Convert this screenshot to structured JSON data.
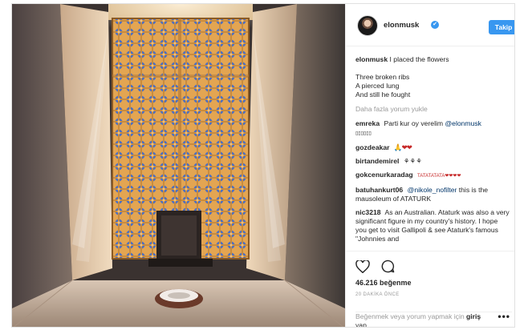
{
  "post": {
    "image_alt": "Mausoleum window with lattice and flowers",
    "author": "elonmusk",
    "verified_mark": "✔",
    "follow_label": "Takip Et",
    "caption_user": "elonmusk",
    "caption_text": "I placed the flowers",
    "poem": [
      "Three broken ribs",
      "A pierced lung",
      "And still he fought"
    ],
    "load_more": "Daha fazla yorum yukle",
    "comments": [
      {
        "user": "emreka",
        "text": "Parti kur oy verelim",
        "mention": "@elonmusk",
        "extra": "▯▯▯▯▯▯"
      },
      {
        "user": "gozdeakar",
        "text": "🙏❤❤"
      },
      {
        "user": "birtandemirel",
        "text": "⚘⚘⚘"
      },
      {
        "user": "gokcenurkaradag",
        "text": "TATATATATA❤❤❤❤"
      },
      {
        "user": "batuhankurt06",
        "mention": "@nikole_nofilter",
        "text": "this is the mausoleum of ATATURK"
      },
      {
        "user": "nic3218",
        "text": "As an Australian. Ataturk was also a very significant figure in my country's history. I hope you get to visit Gallipoli & see Ataturk's famous \"Johnnies and"
      }
    ],
    "likes": "46.216 beğenme",
    "time": "20 DAKİKA ÖNCE",
    "add_comment_prefix": "Beğenmek veya yorum yapmak için",
    "add_comment_login": "giriş",
    "add_comment_suffix": "yap.",
    "more_options": "•••"
  },
  "icons": {
    "like": "heart-icon",
    "comment": "comment-bubble-icon",
    "verified": "verified-badge-icon"
  },
  "colors": {
    "accent": "#3897f0",
    "text": "#262626",
    "muted": "#999999",
    "link": "#003569"
  }
}
